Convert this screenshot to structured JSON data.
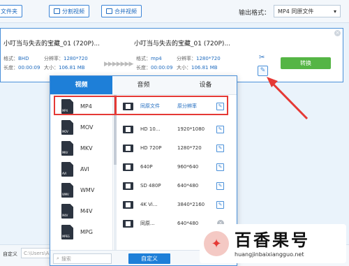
{
  "toolbar": {
    "file_label": "文件夹",
    "split_label": "分割视频",
    "merge_label": "合并视频",
    "output_format_label": "输出格式：",
    "output_format_value": "MP4 同原文件"
  },
  "task": {
    "source_name": "小叮当与失去的宝藏_01 (720P)...",
    "source_format_label": "格式：",
    "source_format": "BHD",
    "source_res_label": "分辨率：",
    "source_res": "1280*720",
    "source_duration_label": "长度：",
    "source_duration": "00:00:09",
    "source_size_label": "大小：",
    "source_size": "106.81 MB",
    "target_name": "小叮当与失去的宝藏_01 (720P)...",
    "target_format_label": "格式：",
    "target_format": "mp4",
    "target_res_label": "分辨率：",
    "target_res": "1280*720",
    "target_duration_label": "长度：",
    "target_duration": "00:00:09",
    "target_size_label": "大小：",
    "target_size": "106.81 MB",
    "convert_label": "转换",
    "close_glyph": "×",
    "arrow_glyph": "▶▶▶▶▶▶▶"
  },
  "popup": {
    "tabs": [
      "视频",
      "音频",
      "设备"
    ],
    "formats": [
      {
        "label": "MP4",
        "icon": "MP4"
      },
      {
        "label": "MOV",
        "icon": "MOV"
      },
      {
        "label": "MKV",
        "icon": "MKV"
      },
      {
        "label": "AVI",
        "icon": "AVI"
      },
      {
        "label": "WMV",
        "icon": "WMV"
      },
      {
        "label": "M4V",
        "icon": "M4V"
      },
      {
        "label": "MPG",
        "icon": "MPEG"
      }
    ],
    "presets": [
      {
        "name": "同原文件",
        "res": "原分辨率",
        "action": "edit"
      },
      {
        "name": "HD 10...",
        "res": "1920*1080",
        "action": "edit"
      },
      {
        "name": "HD 720P",
        "res": "1280*720",
        "action": "edit"
      },
      {
        "name": "640P",
        "res": "960*640",
        "action": "edit"
      },
      {
        "name": "SD 480P",
        "res": "640*480",
        "action": "edit"
      },
      {
        "name": "4K Vi...",
        "res": "3840*2160",
        "action": "edit"
      },
      {
        "name": "同原...",
        "res": "640*480",
        "action": "delete"
      }
    ],
    "search_placeholder": "搜索",
    "custom_label": "自定义"
  },
  "bottom": {
    "custom_label": "自定义",
    "path": "C:\\Users\\A"
  },
  "watermark": {
    "title": "百香果号",
    "url": "huangjinbaixiangguo.net"
  },
  "colors": {
    "accent": "#1e7fd8",
    "convert": "#55b545",
    "highlight": "#e53935"
  }
}
